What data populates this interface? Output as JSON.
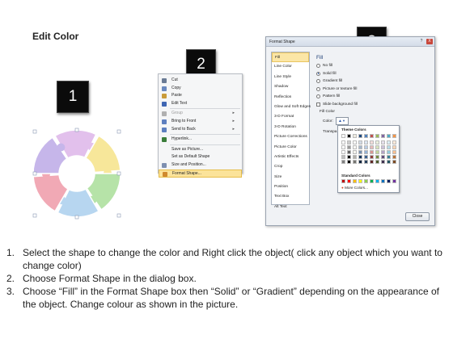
{
  "page_title": "Edit Color",
  "badges": [
    "1",
    "2",
    "3"
  ],
  "context_menu": {
    "items": [
      {
        "label": "Cut",
        "icon": "scissors-icon",
        "disabled": false,
        "submenu": false
      },
      {
        "label": "Copy",
        "icon": "copy-icon",
        "disabled": false,
        "submenu": false
      },
      {
        "label": "Paste",
        "icon": "paste-icon",
        "disabled": false,
        "submenu": false
      },
      {
        "label": "Edit Text",
        "icon": "edit-text-icon",
        "disabled": false,
        "submenu": false
      },
      {
        "label": "Group",
        "icon": "group-icon",
        "disabled": true,
        "submenu": true
      },
      {
        "label": "Bring to Front",
        "icon": "bring-front-icon",
        "disabled": false,
        "submenu": true
      },
      {
        "label": "Send to Back",
        "icon": "send-back-icon",
        "disabled": false,
        "submenu": true
      },
      {
        "label": "Hyperlink...",
        "icon": "hyperlink-icon",
        "disabled": false,
        "submenu": false
      },
      {
        "label": "Save as Picture...",
        "icon": "",
        "disabled": false,
        "submenu": false
      },
      {
        "label": "Set as Default Shape",
        "icon": "",
        "disabled": false,
        "submenu": false
      },
      {
        "label": "Size and Position...",
        "icon": "size-icon",
        "disabled": false,
        "submenu": false
      },
      {
        "label": "Format Shape...",
        "icon": "format-shape-icon",
        "disabled": false,
        "submenu": false,
        "active": true
      }
    ]
  },
  "dialog": {
    "title": "Format Shape",
    "help": "?",
    "close_x": "X",
    "categories": [
      "Fill",
      "Line Color",
      "Line Style",
      "Shadow",
      "Reflection",
      "Glow and Soft Edges",
      "3-D Format",
      "3-D Rotation",
      "Picture Corrections",
      "Picture Color",
      "Artistic Effects",
      "Crop",
      "Size",
      "Position",
      "Text Box",
      "Alt Text"
    ],
    "selected_category": "Fill",
    "fill_heading": "Fill",
    "fill_options": [
      {
        "label": "No fill",
        "type": "radio",
        "checked": false
      },
      {
        "label": "Solid fill",
        "type": "radio",
        "checked": true
      },
      {
        "label": "Gradient fill",
        "type": "radio",
        "checked": false
      },
      {
        "label": "Picture or texture fill",
        "type": "radio",
        "checked": false
      },
      {
        "label": "Pattern fill",
        "type": "radio",
        "checked": false
      },
      {
        "label": "Slide background fill",
        "type": "checkbox",
        "checked": false
      }
    ],
    "fill_color_label": "Fill Color",
    "color_label": "Color:",
    "transparency_label": "Transpa",
    "color_popup": {
      "theme_colors_label": "Theme Colors",
      "standard_colors_label": "Standard Colors",
      "more_colors_label": "More Colors...",
      "theme_colors": [
        "#ffffff",
        "#000000",
        "#eeece1",
        "#1f497d",
        "#4f81bd",
        "#c0504d",
        "#9bbb59",
        "#8064a2",
        "#4bacc6",
        "#f79646"
      ],
      "standard_colors": [
        "#c00000",
        "#ff0000",
        "#ffc000",
        "#ffff00",
        "#92d050",
        "#00b050",
        "#00b0f0",
        "#0070c0",
        "#002060",
        "#7030a0"
      ]
    },
    "close_button": "Close"
  },
  "wheel_colors": [
    "#e2c0ec",
    "#f7e79a",
    "#b6e3a8",
    "#b7d6f0",
    "#f1a9b5",
    "#c6b6ea"
  ],
  "instructions": [
    {
      "num": "1.",
      "text": "Select the shape to change the color and Right click the object( click any object which you want to change color)"
    },
    {
      "num": "2.",
      "text": "Choose Format Shape in the dialog box."
    },
    {
      "num": "3.",
      "text": "Choose “Fill” in the Format Shape box then “Solid” or “Gradient” depending on the appearance of the object. Change colour as shown in the picture."
    }
  ]
}
